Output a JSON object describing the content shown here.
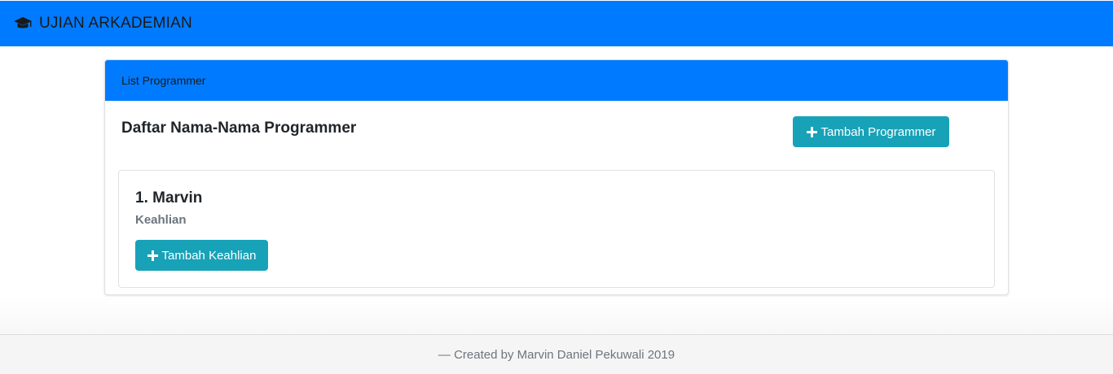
{
  "navbar": {
    "brand": "UJIAN ARKADEMIAN",
    "brand_icon": "graduation-cap-icon",
    "color": "#007bff"
  },
  "card": {
    "header": "List Programmer",
    "title": "Daftar Nama-Nama Programmer",
    "add_programmer_label": "Tambah Programmer",
    "programmers": [
      {
        "name": "1. Marvin",
        "skill_label": "Keahlian",
        "add_skill_label": "Tambah Keahlian"
      }
    ]
  },
  "footer": {
    "text": "— Created by Marvin Daniel Pekuwali 2019"
  },
  "colors": {
    "primary": "#007bff",
    "info": "#17a2b8"
  }
}
